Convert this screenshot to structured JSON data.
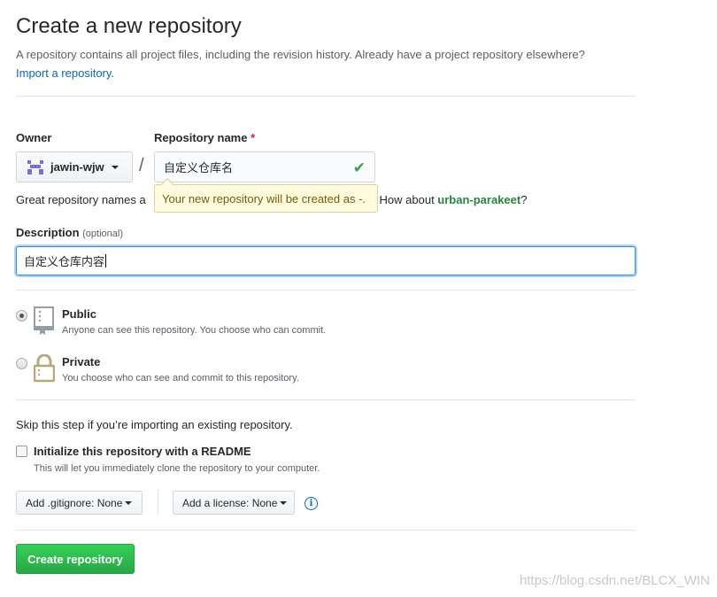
{
  "header": {
    "title": "Create a new repository",
    "subtitle": "A repository contains all project files, including the revision history. Already have a project repository elsewhere?",
    "import_link": "Import a repository."
  },
  "owner": {
    "label": "Owner",
    "value": "jawin-wjw"
  },
  "repo": {
    "label": "Repository name",
    "required_mark": "*",
    "value": "自定义仓库名",
    "separator": "/"
  },
  "hint": {
    "prefix": "Great repository names a",
    "suffix": "? How about ",
    "suggestion": "urban-parakeet",
    "end": "?"
  },
  "tooltip": "Your new repository will be created as -.",
  "description": {
    "label": "Description",
    "optional": "(optional)",
    "value": "自定义仓库内容"
  },
  "visibility": [
    {
      "title": "Public",
      "desc": "Anyone can see this repository. You choose who can commit.",
      "selected": true
    },
    {
      "title": "Private",
      "desc": "You choose who can see and commit to this repository.",
      "selected": false
    }
  ],
  "skip_text": "Skip this step if you’re importing an existing repository.",
  "readme": {
    "label": "Initialize this repository with a README",
    "desc": "This will let you immediately clone the repository to your computer.",
    "checked": false
  },
  "gitignore_btn": "Add .gitignore: None",
  "license_btn": "Add a license: None",
  "create_btn": "Create repository",
  "watermark": "https://blog.csdn.net/BLCX_WIN",
  "colors": {
    "primary": "#28a745",
    "link": "#0366d6",
    "suggestion": "#22863a",
    "private_icon": "#b8a878"
  }
}
